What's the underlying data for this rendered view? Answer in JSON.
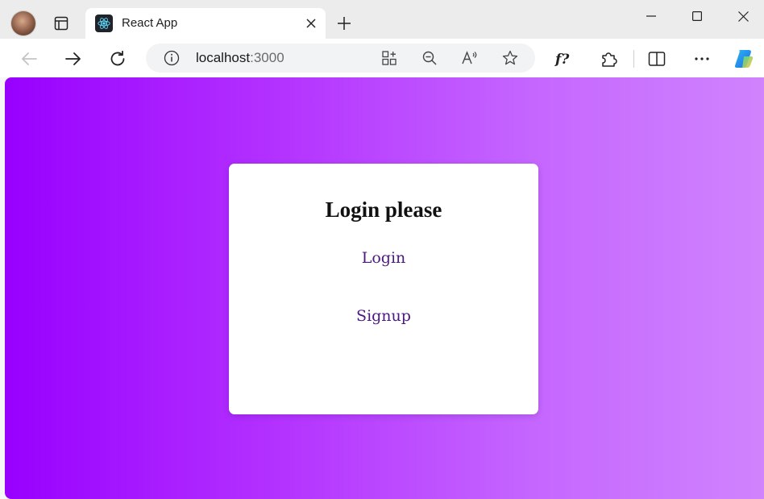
{
  "browser": {
    "tab": {
      "title": "React App",
      "favicon": "react-logo-icon"
    },
    "address_bar": {
      "host": "localhost",
      "port": ":3000"
    },
    "icons": {
      "profile": "avatar",
      "tab_actions": "tab-actions-icon",
      "close_tab": "close-icon",
      "new_tab": "plus-icon",
      "minimize": "minimize-icon",
      "maximize": "maximize-icon",
      "close_window": "close-icon",
      "back": "arrow-left-icon",
      "forward": "arrow-right-icon",
      "refresh": "refresh-icon",
      "site_info": "info-icon",
      "apps": "apps-icon",
      "zoom": "zoom-out-icon",
      "read_aloud": "read-aloud-icon",
      "favorite": "star-icon",
      "formula": "formula-icon",
      "extensions": "puzzle-icon",
      "split_screen": "split-screen-icon",
      "more": "more-icon",
      "copilot": "copilot-icon"
    }
  },
  "page": {
    "background": {
      "gradient_start": "#9800ff",
      "gradient_end": "#d083fd"
    },
    "card": {
      "title": "Login please",
      "login_link": "Login",
      "signup_link": "Signup",
      "link_color": "#4b1a7e"
    }
  }
}
